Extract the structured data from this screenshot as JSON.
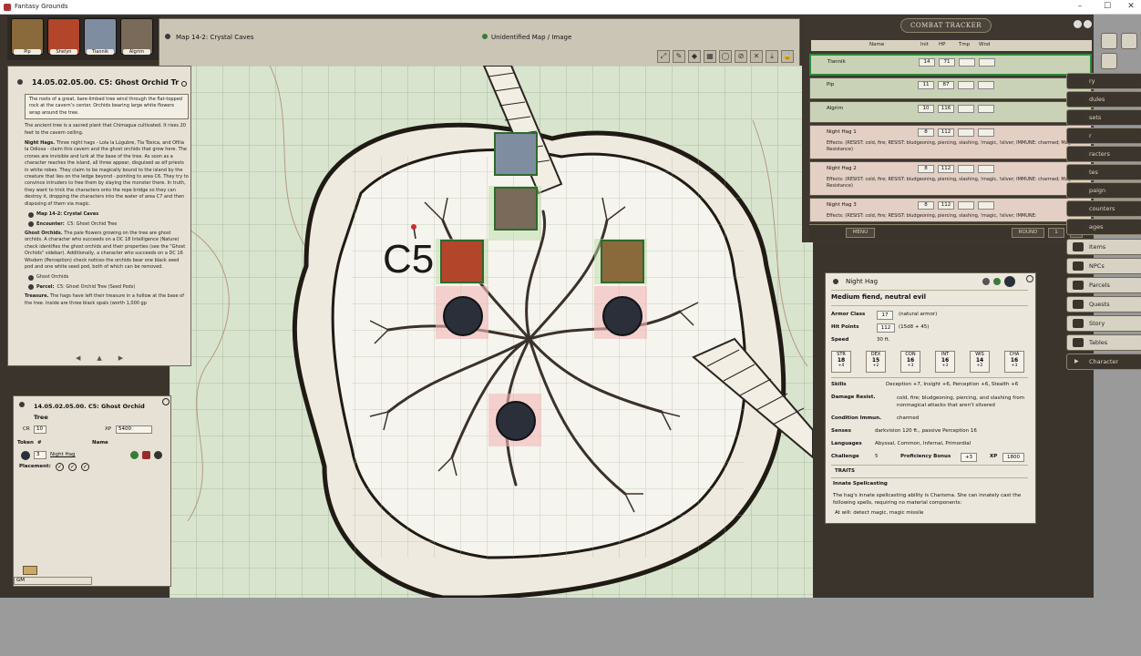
{
  "window": {
    "title": "Fantasy Grounds",
    "minimize": "–",
    "maximize": "☐",
    "close": "✕"
  },
  "portraits": [
    {
      "name": "Pip",
      "color": "#8a6a3b"
    },
    {
      "name": "Shelyn",
      "color": "#b2452a"
    },
    {
      "name": "Tiannik",
      "color": "#7f8da1"
    },
    {
      "name": "Algrim",
      "color": "#7a6a5a"
    }
  ],
  "map": {
    "title": "Map 14-2: Crystal Caves",
    "subtitle": "Unidentified Map / Image",
    "room_label": "C5",
    "tools": [
      "⤢",
      "✎",
      "◆",
      "▦",
      "◯",
      "⊘",
      "✕",
      "⤓",
      "🔒"
    ]
  },
  "story": {
    "title": "14.05.02.05.00. C5: Ghost Orchid Tr",
    "boxed": "The roots of a great, bare-limbed tree wind through the flat-topped rock at the cavern’s center. Orchids bearing large white flowers wrap around the tree.",
    "p1": "The ancient tree is a sacred plant that Chimagua cultivated. It rises 20 feet to the cavern ceiling.",
    "p2_bold": "Night Hags.",
    "p2": " Three night hags - Lola la Lúgubre, Tía Tóxica, and Ofilia la Odiosa - claim this cavern and the ghost orchids that grow here. The crones are invisible and lurk at the base of the tree. As soon as a character reaches the island, all three appear, disguised as elf priests in white robes. They claim to be magically bound to the island by the creature that lies on the ledge beyond - pointing to area C6. They try to convince intruders to free them by slaying the monster there. In truth, they want to trick the characters onto the rope bridge so they can destroy it, dropping the characters into the water of area C7 and then disposing of them via magic.",
    "link1": "Map 14-2: Crystal Caves",
    "link2_label": "Encounter:",
    "link2": "C5: Ghost Orchid Tree",
    "p3_bold": "Ghost Orchids.",
    "p3": " The pale flowers growing on the tree are ghost orchids. A character who succeeds on a DC 18 Intelligence (Nature) check identifies the ghost orchids and their properties (see the \"Ghost Orchids\" sidebar). Additionally, a character who succeeds on a DC 16 Wisdom (Perception) check notices the orchids bear one black seed pod and one white seed pod, both of which can be removed.",
    "link3": "Ghost Orchids",
    "link4_label": "Parcel:",
    "link4": "C5: Ghost Orchid Tree (Seed Pods)",
    "p4_bold": "Treasure.",
    "p4": " The hags have left their treasure in a hollow at the base of the tree. Inside are three black opals (worth 1,000 gp",
    "nav_prev": "◀",
    "nav_up": "▲",
    "nav_next": "▶"
  },
  "encounter": {
    "title": "14.05.02.05.00. C5: Ghost Orchid Tree",
    "cr_label": "CR",
    "cr": "10",
    "xp_label": "XP",
    "xp": "5400",
    "col_token": "Token",
    "col_count": "#",
    "col_name": "Name",
    "row_count": "3",
    "row_name": "Night Hag",
    "placement_label": "Placement:",
    "chat_mode": "GM"
  },
  "combat_tracker": {
    "title": "COMBAT TRACKER",
    "cols": {
      "name": "Name",
      "init": "Init",
      "hp": "HP",
      "tmp": "Tmp",
      "wnd": "Wnd"
    },
    "rows": [
      {
        "name": "Tiannik",
        "init": "14",
        "hp": "71",
        "type": "friend",
        "active": true
      },
      {
        "name": "Pip",
        "init": "11",
        "hp": "87",
        "type": "friend",
        "active": false
      },
      {
        "name": "Algrim",
        "init": "10",
        "hp": "116",
        "type": "friend",
        "active": false
      },
      {
        "name": "Night Hag 1",
        "init": "8",
        "hp": "112",
        "type": "foe",
        "effects": "Effects: (RESIST: cold, fire; RESIST: bludgeoning, piercing, slashing, !magic, !silver; IMMUNE: charmed; Magic Resistance)"
      },
      {
        "name": "Night Hag 2",
        "init": "8",
        "hp": "112",
        "type": "foe",
        "effects": "Effects: (RESIST: cold, fire; RESIST: bludgeoning, piercing, slashing, !magic, !silver; IMMUNE: charmed; Magic Resistance)"
      },
      {
        "name": "Night Hag 3",
        "init": "8",
        "hp": "112",
        "type": "foe",
        "effects": "Effects: (RESIST: cold, fire; RESIST: bludgeoning, piercing, slashing, !magic, !silver; IMMUNE:"
      }
    ],
    "menu": "MENU",
    "round_label": "ROUND",
    "round": "1"
  },
  "sidebar": {
    "items": [
      "ry",
      "dules",
      "sets",
      "r",
      "racters",
      "tes",
      "paign",
      "counters",
      "ages",
      "Items",
      "NPCs",
      "Parcels",
      "Quests",
      "Story",
      "Tables",
      "Character"
    ]
  },
  "npc": {
    "name": "Night Hag",
    "type": "Medium fiend, neutral evil",
    "ac_label": "Armor Class",
    "ac": "17",
    "ac_note": "(natural armor)",
    "hp_label": "Hit Points",
    "hp": "112",
    "hp_note": "(15d8 + 45)",
    "speed_label": "Speed",
    "speed": "30 ft.",
    "abilities": [
      {
        "name": "STR",
        "score": "18",
        "mod": "+4"
      },
      {
        "name": "DEX",
        "score": "15",
        "mod": "+2"
      },
      {
        "name": "CON",
        "score": "16",
        "mod": "+3"
      },
      {
        "name": "INT",
        "score": "16",
        "mod": "+3"
      },
      {
        "name": "WIS",
        "score": "14",
        "mod": "+2"
      },
      {
        "name": "CHA",
        "score": "16",
        "mod": "+3"
      }
    ],
    "skills_label": "Skills",
    "skills": "Deception +7, Insight +6, Perception +6, Stealth +6",
    "dr_label": "Damage Resist.",
    "dr": "cold, fire; bludgeoning, piercing, and slashing from nonmagical attacks that aren't silvered",
    "ci_label": "Condition Immun.",
    "ci": "charmed",
    "senses_label": "Senses",
    "senses": "darkvision 120 ft., passive Perception 16",
    "lang_label": "Languages",
    "lang": "Abyssal, Common, Infernal, Primordial",
    "challenge_label": "Challenge",
    "challenge": "5",
    "pb_label": "Proficiency Bonus",
    "pb": "+3",
    "xp_label": "XP",
    "xp": "1800",
    "traits_label": "TRAITS",
    "trait_name": "Innate Spellcasting",
    "trait_text": "The hag's innate spellcasting ability is Charisma. She can innately cast the following spells, requiring no material components:",
    "trait_text2": "At will: detect magic, magic missile"
  }
}
